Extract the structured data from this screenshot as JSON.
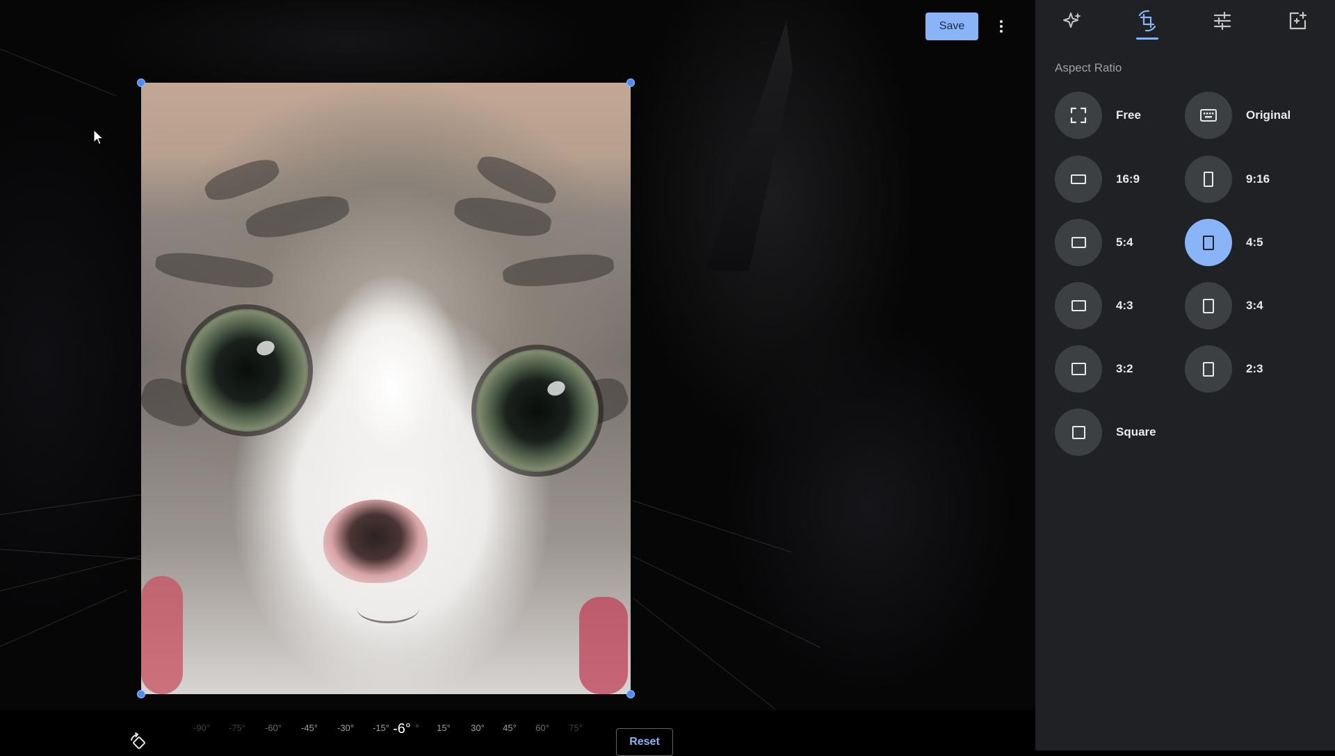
{
  "toolbar": {
    "save_label": "Save",
    "more_icon": "more-vert-icon"
  },
  "panel": {
    "tabs": [
      {
        "name": "suggestions",
        "icon": "sparkle-icon",
        "selected": false
      },
      {
        "name": "crop-rotate",
        "icon": "crop-rotate-icon",
        "selected": true
      },
      {
        "name": "adjust",
        "icon": "tune-icon",
        "selected": false
      },
      {
        "name": "markup",
        "icon": "add-to-photo-icon",
        "selected": false
      }
    ],
    "section_title": "Aspect Ratio",
    "ratios": [
      {
        "label": "Free",
        "icon": "free-crop-icon",
        "selected": false
      },
      {
        "label": "Original",
        "icon": "original-ratio-icon",
        "selected": false
      },
      {
        "label": "16:9",
        "icon": "landscape-ratio-icon",
        "selected": false
      },
      {
        "label": "9:16",
        "icon": "portrait-ratio-icon",
        "selected": false
      },
      {
        "label": "5:4",
        "icon": "landscape-ratio-icon",
        "selected": false
      },
      {
        "label": "4:5",
        "icon": "portrait-ratio-icon",
        "selected": true
      },
      {
        "label": "4:3",
        "icon": "landscape-ratio-icon",
        "selected": false
      },
      {
        "label": "3:4",
        "icon": "portrait-ratio-icon",
        "selected": false
      },
      {
        "label": "3:2",
        "icon": "landscape-ratio-icon",
        "selected": false
      },
      {
        "label": "2:3",
        "icon": "portrait-ratio-icon",
        "selected": false
      },
      {
        "label": "Square",
        "icon": "square-ratio-icon",
        "selected": false
      }
    ]
  },
  "rotation": {
    "ticks": [
      "-90°",
      "-75°",
      "-60°",
      "-45°",
      "-30°",
      "-15°",
      "15°",
      "30°",
      "45°",
      "60°",
      "75°"
    ],
    "current": "-6°",
    "current_suffix": "°",
    "reset_label": "Reset",
    "rotate_icon": "rotate-left-icon"
  },
  "colors": {
    "accent": "#8ab4f8",
    "panel_bg": "#202124",
    "handle": "#4c8df6"
  }
}
